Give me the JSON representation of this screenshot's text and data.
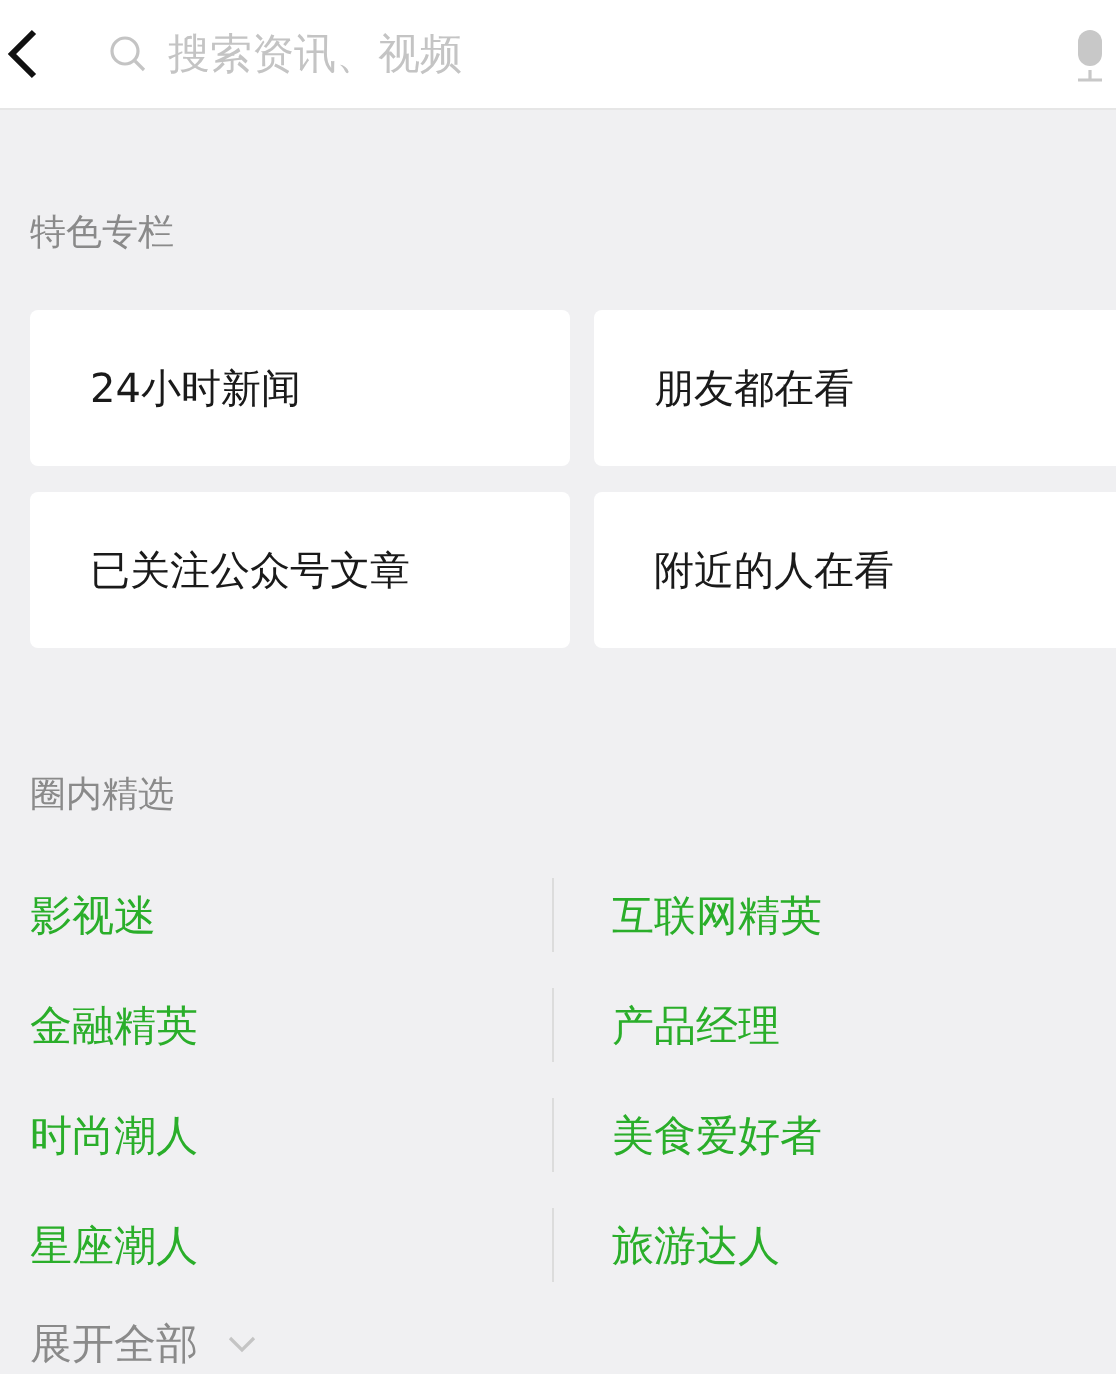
{
  "search": {
    "placeholder": "搜索资讯、视频"
  },
  "featured": {
    "title": "特色专栏",
    "cards": [
      {
        "label": "24小时新闻"
      },
      {
        "label": "朋友都在看"
      },
      {
        "label": "已关注公众号文章"
      },
      {
        "label": "附近的人在看"
      }
    ]
  },
  "circles": {
    "title": "圈内精选",
    "items": [
      {
        "label": "影视迷"
      },
      {
        "label": "互联网精英"
      },
      {
        "label": "金融精英"
      },
      {
        "label": "产品经理"
      },
      {
        "label": "时尚潮人"
      },
      {
        "label": "美食爱好者"
      },
      {
        "label": "星座潮人"
      },
      {
        "label": "旅游达人"
      }
    ],
    "expand": "展开全部"
  }
}
